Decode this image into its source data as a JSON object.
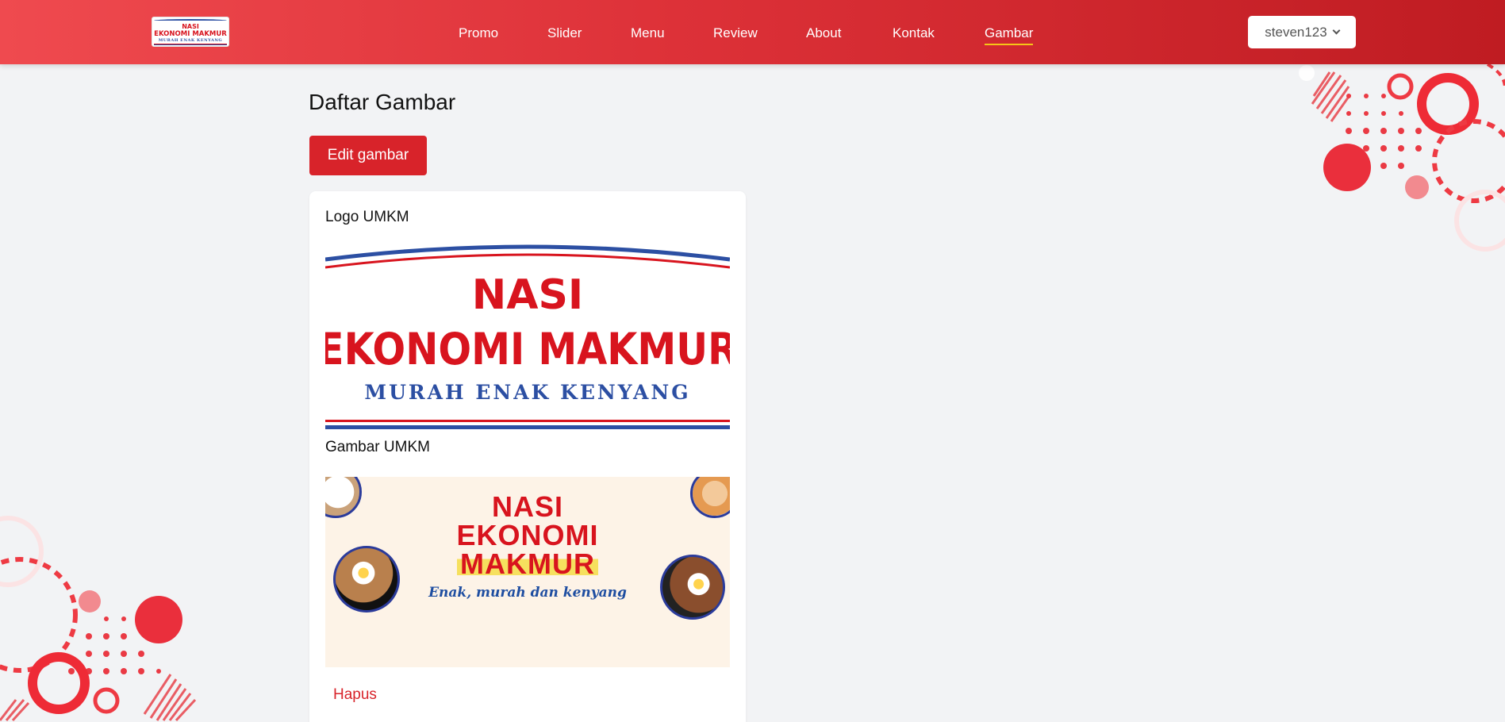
{
  "header": {
    "logo": {
      "line1": "NASI",
      "line2": "EKONOMI MAKMUR",
      "line3": "MURAH ENAK KENYANG"
    },
    "nav": [
      "Promo",
      "Slider",
      "Menu",
      "Review",
      "About",
      "Kontak",
      "Gambar"
    ],
    "active_nav": "Gambar",
    "user": {
      "name": "steven123",
      "icon": "chevron-down-icon"
    }
  },
  "main": {
    "title": "Daftar Gambar",
    "edit_button": "Edit gambar",
    "card": {
      "logo_label": "Logo UMKM",
      "logo_image": {
        "line1": "NASI",
        "line2": "EKONOMI MAKMUR",
        "line3": "MURAH ENAK KENYANG"
      },
      "banner_label": "Gambar UMKM",
      "banner_image": {
        "line1": "NASI",
        "line2": "EKONOMI",
        "line3": "MAKMUR",
        "tagline": "Enak, murah dan kenyang"
      },
      "delete_link": "Hapus"
    }
  },
  "colors": {
    "header_start": "#ef4a4f",
    "header_end": "#bf1c22",
    "accent_red": "#d8232a",
    "logo_blue": "#2c4fa3",
    "active_underline": "#f5c518",
    "background": "#f2f3f5"
  }
}
